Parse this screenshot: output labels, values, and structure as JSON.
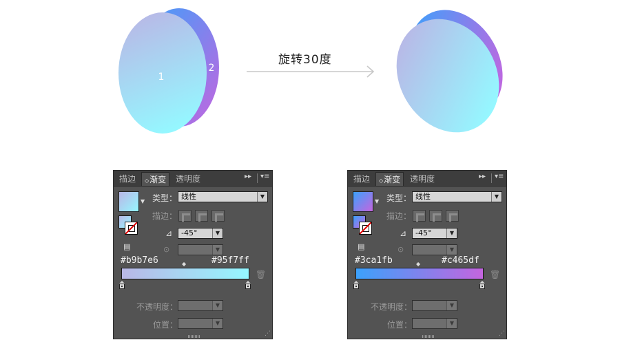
{
  "illustration": {
    "left": {
      "back_shape_label": "2",
      "front_shape_label": "1",
      "back_gradient": [
        "#3ca1fb",
        "#c465df"
      ],
      "front_gradient": [
        "#b9b7e6",
        "#95f7ff"
      ]
    },
    "arrow_text": "旋转30度"
  },
  "panels": [
    {
      "tabs": [
        "描边",
        "渐变",
        "透明度"
      ],
      "active_tab": "渐变",
      "type_label": "类型：",
      "type_value": "线性",
      "stroke_label": "描边：",
      "angle_value": "-45°",
      "opacity_label": "不透明度：",
      "position_label": "位置：",
      "stop_left_hex": "#b9b7e6",
      "stop_right_hex": "#95f7ff",
      "gradient_start": "#b9b7e6",
      "gradient_end": "#95f7ff"
    },
    {
      "tabs": [
        "描边",
        "渐变",
        "透明度"
      ],
      "active_tab": "渐变",
      "type_label": "类型：",
      "type_value": "线性",
      "stroke_label": "描边：",
      "angle_value": "-45°",
      "opacity_label": "不透明度：",
      "position_label": "位置：",
      "stop_left_hex": "#3ca1fb",
      "stop_right_hex": "#c465df",
      "gradient_start": "#3ca1fb",
      "gradient_end": "#c465df"
    }
  ],
  "colors": {
    "panel_bg": "#535353",
    "tab_bar_bg": "#3d3d3d",
    "arrow": "#c8c8c8"
  }
}
